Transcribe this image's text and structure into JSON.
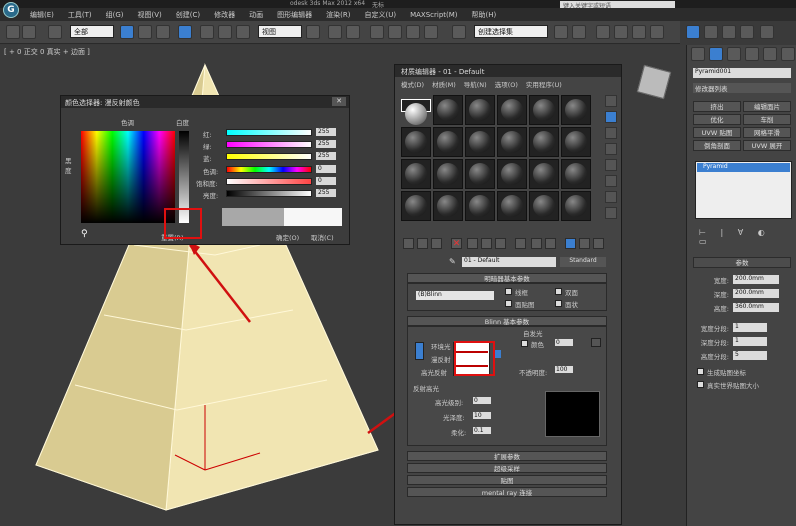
{
  "app": {
    "title_fragment": "odesk 3ds Max 2012 x64",
    "title_suffix": "无标",
    "search_placeholder": "键入关键字或短语"
  },
  "menu": [
    "编辑(E)",
    "工具(T)",
    "组(G)",
    "视图(V)",
    "创建(C)",
    "修改器",
    "动画",
    "图形编辑器",
    "渲染(R)",
    "自定义(U)",
    "MAXScript(M)",
    "帮助(H)"
  ],
  "toolbar": {
    "filter": "全部",
    "ref_coord": "视图",
    "named_sel": "创建选择集"
  },
  "viewport": {
    "label": "[ + 0 正交 0 真实 + 边面 ]"
  },
  "color_picker": {
    "title": "颜色选择器: 漫反射颜色",
    "hue_label": "色调",
    "white_label": "白度",
    "black_label": "黑度",
    "channels": [
      {
        "label": "红:",
        "value": "255"
      },
      {
        "label": "绿:",
        "value": "255"
      },
      {
        "label": "蓝:",
        "value": "255"
      },
      {
        "label": "色调:",
        "value": "0"
      },
      {
        "label": "饱和度:",
        "value": "0"
      },
      {
        "label": "亮度:",
        "value": "255"
      }
    ],
    "reset": "重置(R)",
    "ok": "确定(O)",
    "cancel": "取消(C)",
    "close": "✕"
  },
  "material_editor": {
    "title": "材质编辑器 - 01 - Default",
    "menu": [
      "模式(D)",
      "材质(M)",
      "导航(N)",
      "选项(O)",
      "实用程序(U)"
    ],
    "material_name": "01 - Default",
    "material_type": "Standard",
    "shader_rollout": "明暗器基本参数",
    "shader": "(B)Blinn",
    "wire": "线框",
    "two_sided": "双面",
    "face_map": "面贴图",
    "faceted": "面状",
    "blinn_rollout": "Blinn 基本参数",
    "self_illum": "自发光",
    "color": "颜色",
    "self_illum_value": "0",
    "ambient": "环境光",
    "diffuse": "漫反射",
    "specular": "高光反射",
    "opacity_label": "不透明度:",
    "opacity": "100",
    "spec_highlights": "反射高光",
    "spec_level_label": "高光级别:",
    "spec_level": "0",
    "gloss_label": "光泽度:",
    "gloss": "10",
    "soften_label": "柔化:",
    "soften": "0.1",
    "rollouts": [
      "扩展参数",
      "超级采样",
      "贴图",
      "mental ray 连接"
    ]
  },
  "command_panel": {
    "object_name": "Pyramid001",
    "modifier_list": "修改器列表",
    "buttons": [
      "挤出",
      "编辑面片",
      "优化",
      "车削",
      "UVW 贴图",
      "网格平滑",
      "倒角剖面",
      "UVW 展开"
    ],
    "stack_item": "Pyramid",
    "params_title": "参数",
    "params": [
      {
        "label": "宽度:",
        "value": "200.0mm"
      },
      {
        "label": "深度:",
        "value": "200.0mm"
      },
      {
        "label": "高度:",
        "value": "360.0mm"
      }
    ],
    "segs": [
      {
        "label": "宽度分段:",
        "value": "1"
      },
      {
        "label": "深度分段:",
        "value": "1"
      },
      {
        "label": "高度分段:",
        "value": "5"
      }
    ],
    "gen_map": "生成贴图坐标",
    "real_world": "真实世界贴图大小"
  },
  "colors": {
    "accent": "#3b7fd0",
    "highlight_box": "#e01010",
    "pyramid": "#eee1a6"
  }
}
